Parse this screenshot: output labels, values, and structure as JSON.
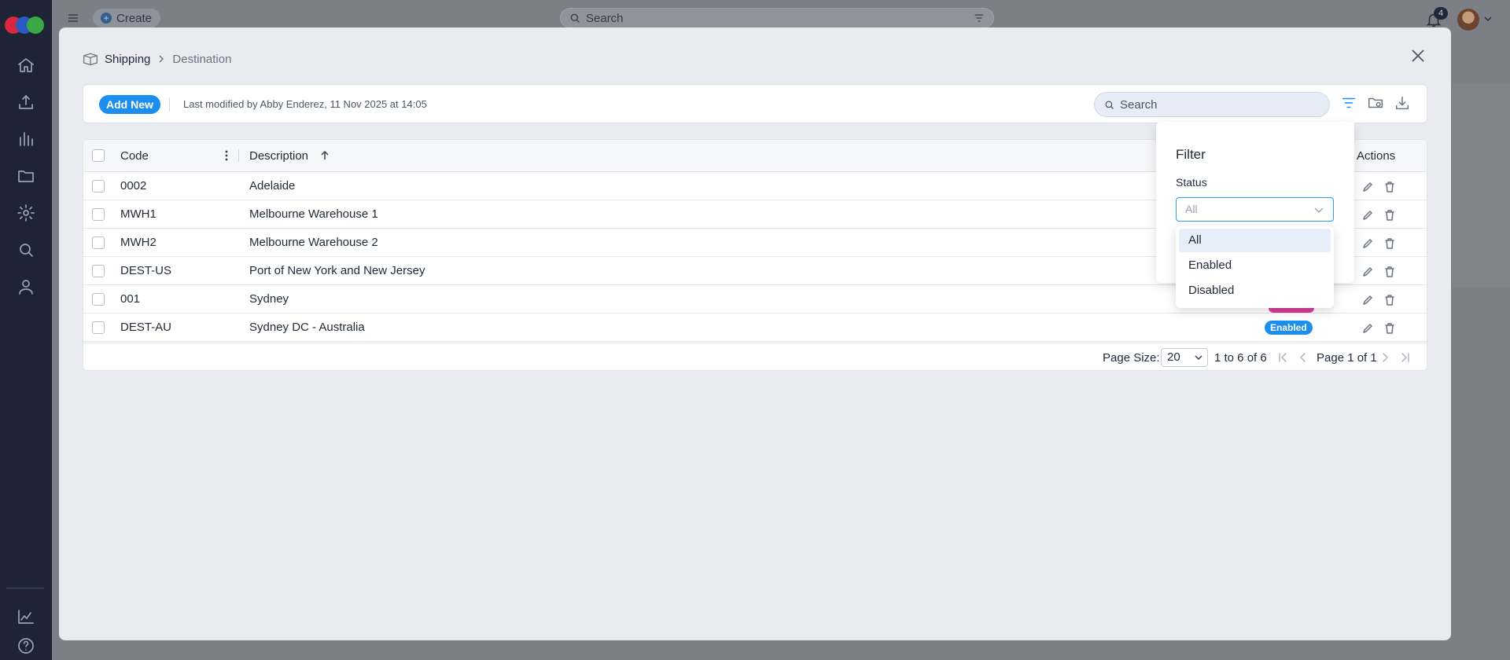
{
  "topbar": {
    "create_label": "Create",
    "search_placeholder": "Search",
    "notification_count": "4"
  },
  "breadcrumb": {
    "section": "Shipping",
    "page": "Destination"
  },
  "toolbar": {
    "add_new_label": "Add New",
    "last_modified": "Last modified by Abby Enderez, 11 Nov 2025 at 14:05",
    "search_placeholder": "Search"
  },
  "grid": {
    "columns": {
      "code": "Code",
      "description": "Description",
      "actions": "Actions"
    },
    "rows": [
      {
        "code": "0002",
        "description": "Adelaide"
      },
      {
        "code": "MWH1",
        "description": "Melbourne Warehouse 1"
      },
      {
        "code": "MWH2",
        "description": "Melbourne Warehouse 2"
      },
      {
        "code": "DEST-US",
        "description": "Port of New York and New Jersey"
      },
      {
        "code": "001",
        "description": "Sydney"
      },
      {
        "code": "DEST-AU",
        "description": "Sydney DC - Australia",
        "status": "Enabled"
      }
    ]
  },
  "pager": {
    "page_size_label": "Page Size:",
    "page_size": "20",
    "range": "1 to 6 of 6",
    "page_label": "Page 1 of 1"
  },
  "filter": {
    "title": "Filter",
    "status_label": "Status",
    "status_value": "All",
    "options": [
      "All",
      "Enabled",
      "Disabled"
    ]
  },
  "colors": {
    "primary": "#1b8ef0",
    "rail_bg": "#1e2433",
    "modal_bg": "#e9ebf0",
    "badge_pink": "#d63e9a"
  }
}
